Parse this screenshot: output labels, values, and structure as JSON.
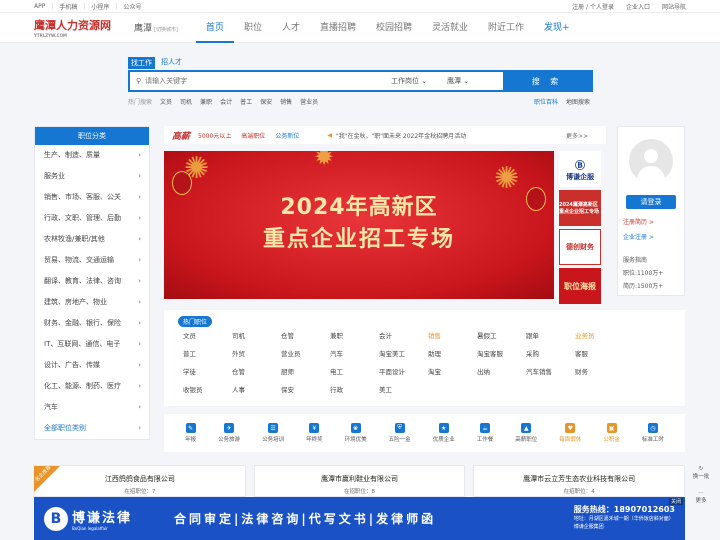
{
  "topbar": {
    "app": "APP",
    "mobile": "手机稿",
    "miniprogram": "小程序",
    "official": "公众号",
    "login": "注册 / 个人登录",
    "company": "企业入口",
    "nav": "网站导航"
  },
  "header": {
    "logo": "鹰潭人力资源网",
    "logo_sub": "YTRLZYW.COM",
    "city": "鹰潭",
    "city_switch": "[切换城市]",
    "nav": [
      "首页",
      "职位",
      "人才",
      "直播招聘",
      "校园招聘",
      "灵活就业",
      "附近工作",
      "发现+"
    ]
  },
  "search": {
    "tab_job": "找工作",
    "tab_talent": "招人才",
    "placeholder": "请输入关键字",
    "type": "工作岗位",
    "city": "鹰潭",
    "button": "搜 索"
  },
  "hot": {
    "label": "热门搜索",
    "items": [
      "文员",
      "司机",
      "兼职",
      "会计",
      "普工",
      "保安",
      "销售",
      "营业员"
    ],
    "right_a": "职位百科",
    "right_b": "地图搜索"
  },
  "sidebar": {
    "title": "职位分类",
    "items": [
      "生产、制造、质量",
      "服务业",
      "销售、市场、客服、公关",
      "行政、文职、管理、后勤",
      "农林牧渔/兼职/其他",
      "贸易、物流、交通运输",
      "翻译、教育、法律、咨询",
      "建筑、房地产、物业",
      "财务、金融、银行、保险",
      "IT、互联网、通信、电子",
      "设计、广告、传媒",
      "化工、能源、制药、医疗",
      "汽车"
    ],
    "all": "全部职位类别"
  },
  "bar": {
    "badge": "高薪",
    "tags": [
      "5000元以上",
      "高端职位",
      "公务新位"
    ],
    "notice": "\"我\"在金秋，\"职\"面未来 2022年金秋招聘月活动",
    "more": "更多>>"
  },
  "banner": {
    "line1": "2024年高新区",
    "line2": "重点企业招工专场"
  },
  "side_ads": {
    "a1": "博谦企服",
    "a2": "2024鹰潭高新区重点企业招工专场",
    "a3": "德创财务",
    "a4": "职位海报"
  },
  "user": {
    "login": "请登录",
    "reg_person": "注册简历 >",
    "reg_company": "企业注册 >",
    "guide": "服务指南",
    "jobs": "职位:1100万+",
    "resumes": "简历:1500万+"
  },
  "hotjobs": {
    "title": "热门职位",
    "items": [
      "文员",
      "司机",
      "仓管",
      "兼职",
      "会计",
      "销售",
      "暑假工",
      "跟单",
      "业务员",
      "普工",
      "外贸",
      "营业员",
      "汽车",
      "淘宝美工",
      "助理",
      "淘宝客服",
      "采购",
      "客服",
      "学徒",
      "仓管",
      "厨师",
      "电工",
      "平面设计",
      "淘宝",
      "出纳",
      "汽车销售",
      "财务",
      "收银员",
      "人事",
      "保安",
      "行政",
      "美工"
    ],
    "orange": [
      5,
      8
    ]
  },
  "icons": [
    "年报",
    "公务旅游",
    "公务培训",
    "年终奖",
    "环境优美",
    "五险一金",
    "优质企业",
    "工作餐",
    "高薪职位",
    "每周假休",
    "公积金",
    "标准工时"
  ],
  "companies": [
    {
      "name": "江西鸽鸽食品有限公司",
      "count": "在招职位：7"
    },
    {
      "name": "鹰潭市赢利鞋业有限公司",
      "count": "在招职位：8"
    },
    {
      "name": "鹰潭市云立芳生态农业科技有限公司",
      "count": "在招职位：4"
    }
  ],
  "ribbon": "名企推荐",
  "footer_ad": {
    "brand": "博谦法律",
    "brand_sub": "BoQian legalaffair",
    "slogan": "合同审定|法律咨询|代写文书|发律师函",
    "phone": "服务热线：18907012603",
    "address": "地址：月湖区嘉禾城一期（华侨饭店斜对面）",
    "company": "博谦企服集团",
    "close": "关闭"
  },
  "float": {
    "a": "换一批",
    "b": "更多"
  }
}
